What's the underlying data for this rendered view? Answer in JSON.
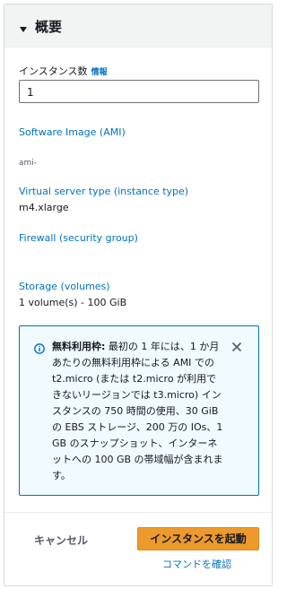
{
  "section": {
    "title": "概要"
  },
  "instance_count": {
    "label": "インスタンス数",
    "info_link": "情報",
    "value": "1"
  },
  "software_image": {
    "label": "Software Image (AMI)",
    "value": "ami-"
  },
  "instance_type": {
    "label": "Virtual server type (instance type)",
    "value": "m4.xlarge"
  },
  "firewall": {
    "label": "Firewall (security group)"
  },
  "storage": {
    "label": "Storage (volumes)",
    "value": "1 volume(s) - 100 GiB"
  },
  "free_tier": {
    "title": "無料利用枠:",
    "body": "最初の 1 年には、1 か月あたりの無料利用枠による AMI での t2.micro (または t2.micro が利用できないリージョンでは t3.micro) インスタンスの 750 時間の使用、30 GiB の EBS ストレージ、200 万の IOs、1 GB のスナップショット、インターネットへの 100 GB の帯域幅が含まれます。"
  },
  "actions": {
    "cancel": "キャンセル",
    "launch": "インスタンスを起動",
    "preview": "コマンドを確認"
  },
  "colors": {
    "link": "#0073bb",
    "launch_button": "#ec9a2c",
    "info_bg": "#f1faff"
  }
}
